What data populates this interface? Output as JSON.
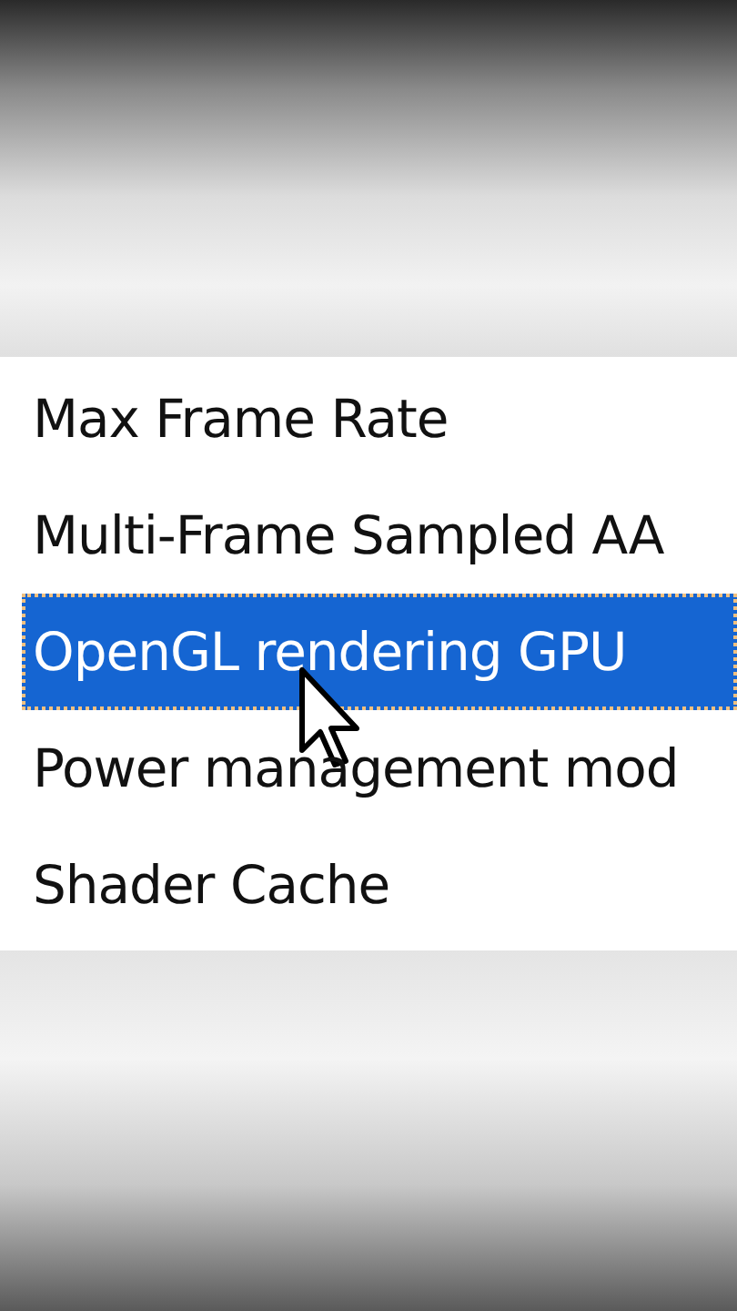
{
  "list": {
    "items": [
      {
        "label": "Max Frame Rate",
        "selected": false,
        "pointer_over": false
      },
      {
        "label": "Multi-Frame Sampled AA",
        "selected": false,
        "pointer_over": false
      },
      {
        "label": "OpenGL rendering GPU",
        "selected": true,
        "pointer_over": true
      },
      {
        "label": "Power management mod",
        "selected": false,
        "pointer_over": false
      },
      {
        "label": "Shader Cache",
        "selected": false,
        "pointer_over": false
      }
    ]
  }
}
